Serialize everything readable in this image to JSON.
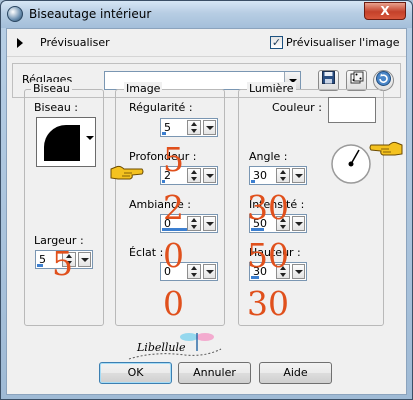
{
  "window": {
    "title": "Biseautage intérieur",
    "close_label": "X"
  },
  "preview": {
    "toggle_label": "Prévisualiser",
    "checkbox_label": "Prévisualiser l'image",
    "checked": true
  },
  "presets": {
    "label": "Réglages",
    "value": ""
  },
  "bevel": {
    "legend": "Biseau",
    "bevel_label": "Biseau :",
    "width_label": "Largeur :",
    "width_value": "5"
  },
  "image": {
    "legend": "Image",
    "smoothness_label": "Régularité :",
    "smoothness_value": "5",
    "depth_label": "Profondeur :",
    "depth_value": "2",
    "ambience_label": "Ambiance :",
    "ambience_value": "0",
    "shininess_label": "Éclat :",
    "shininess_value": "0"
  },
  "light": {
    "legend": "Lumière",
    "color_label": "Couleur :",
    "color": "#ffffff",
    "angle_label": "Angle :",
    "angle_value": "30",
    "intensity_label": "Intensité :",
    "intensity_value": "50",
    "elevation_label": "Hauteur :",
    "elevation_value": "30"
  },
  "watermark": {
    "text": "Libellule"
  },
  "buttons": {
    "ok": "OK",
    "cancel": "Annuler",
    "help": "Aide"
  },
  "colors": {
    "accent_value": "#e0501c",
    "spin_bar": "#3c7fd0"
  }
}
